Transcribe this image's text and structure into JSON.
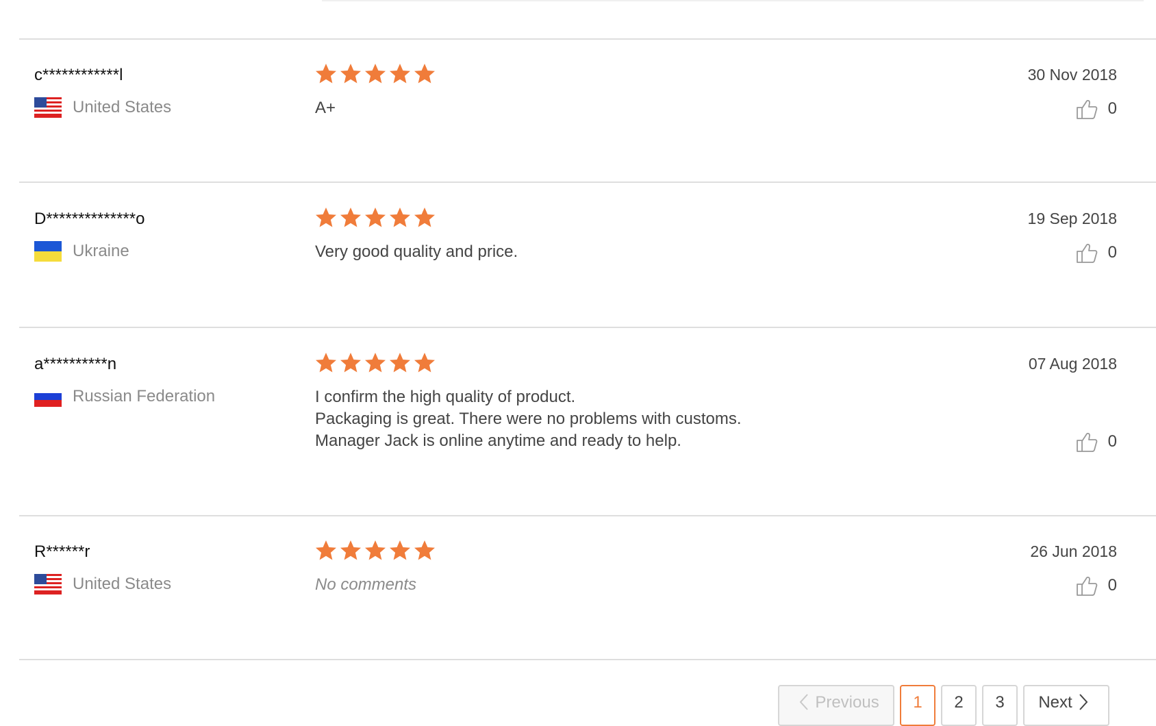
{
  "reviews": [
    {
      "name": "c************l",
      "country": "United States",
      "flag": "us-flag",
      "rating": 5,
      "comment_lines": [
        "A+"
      ],
      "date": "30 Nov 2018",
      "likes": "0"
    },
    {
      "name": "D**************o",
      "country": "Ukraine",
      "flag": "ukraine-flag",
      "rating": 5,
      "comment_lines": [
        "Very good quality and price."
      ],
      "date": "19 Sep 2018",
      "likes": "0"
    },
    {
      "name": "a**********n",
      "country": "Russian Federation",
      "flag": "russia-flag",
      "rating": 5,
      "comment_lines": [
        "I confirm the high quality of product.",
        "Packaging is great. There were no problems with customs.",
        "Manager Jack is online anytime and ready to help."
      ],
      "date": "07 Aug 2018",
      "likes": "0"
    },
    {
      "name": "R******r",
      "country": "United States",
      "flag": "us-flag",
      "rating": 5,
      "comment_lines": [
        "No comments"
      ],
      "comment_empty": true,
      "date": "26 Jun 2018",
      "likes": "0"
    }
  ],
  "pagination": {
    "previous_label": "Previous",
    "pages": [
      "1",
      "2",
      "3"
    ],
    "current_page": "1",
    "next_label": "Next"
  },
  "colors": {
    "star": "#f07c3a",
    "accent": "#f07c3a",
    "divider": "#dedede"
  },
  "icons": [
    "star-icon",
    "thumbs-up-icon",
    "chevron-left-icon",
    "chevron-right-icon"
  ]
}
